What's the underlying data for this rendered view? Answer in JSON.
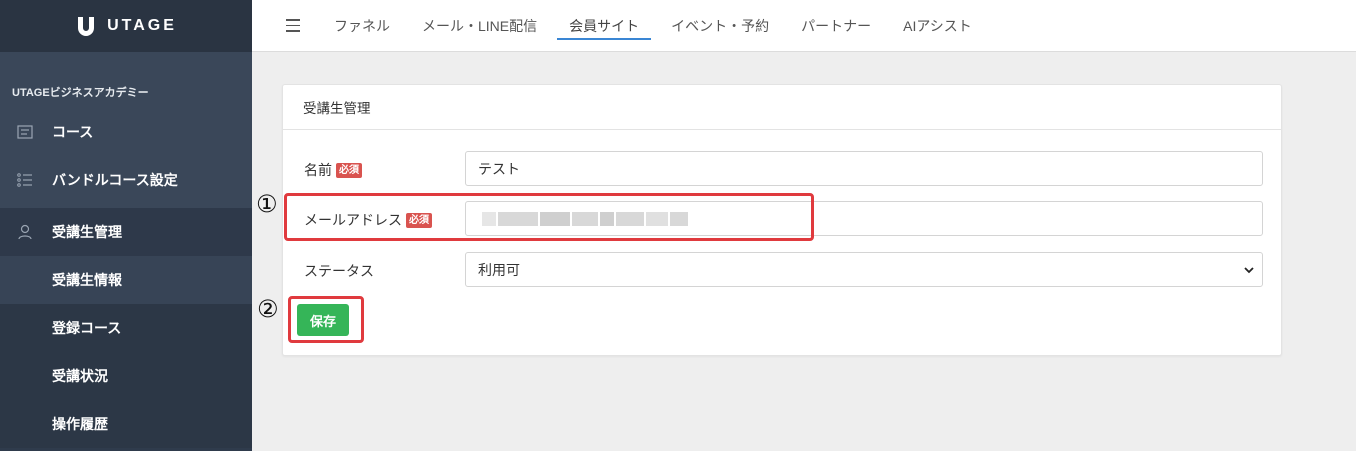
{
  "brand": {
    "name": "UTAGE"
  },
  "sidebar": {
    "group_title": "UTAGEビジネスアカデミー",
    "items": [
      {
        "label": "コース",
        "icon": "document-list-icon"
      },
      {
        "label": "バンドルコース設定",
        "icon": "bullet-list-icon"
      },
      {
        "label": "受講生管理",
        "icon": "user-icon"
      }
    ],
    "subitems": [
      {
        "label": "受講生情報"
      },
      {
        "label": "登録コース"
      },
      {
        "label": "受講状況"
      },
      {
        "label": "操作履歴"
      }
    ]
  },
  "topnav": {
    "tabs": [
      {
        "label": "ファネル"
      },
      {
        "label": "メール・LINE配信"
      },
      {
        "label": "会員サイト"
      },
      {
        "label": "イベント・予約"
      },
      {
        "label": "パートナー"
      },
      {
        "label": "AIアシスト"
      }
    ],
    "active_tab": "会員サイト"
  },
  "card": {
    "title": "受講生管理",
    "fields": {
      "name": {
        "label": "名前",
        "required_badge": "必須",
        "value": "テスト"
      },
      "email": {
        "label": "メールアドレス",
        "required_badge": "必須",
        "value": ""
      },
      "status": {
        "label": "ステータス",
        "value": "利用可"
      }
    },
    "save_label": "保存"
  },
  "annotations": {
    "one": "①",
    "two": "②"
  },
  "colors": {
    "sidebar_bg": "#2f3b4c",
    "active_tab_underline": "#3a86d4",
    "save_button": "#35b558",
    "required_badge": "#d9534f",
    "annotation_box": "#e03a3e"
  }
}
